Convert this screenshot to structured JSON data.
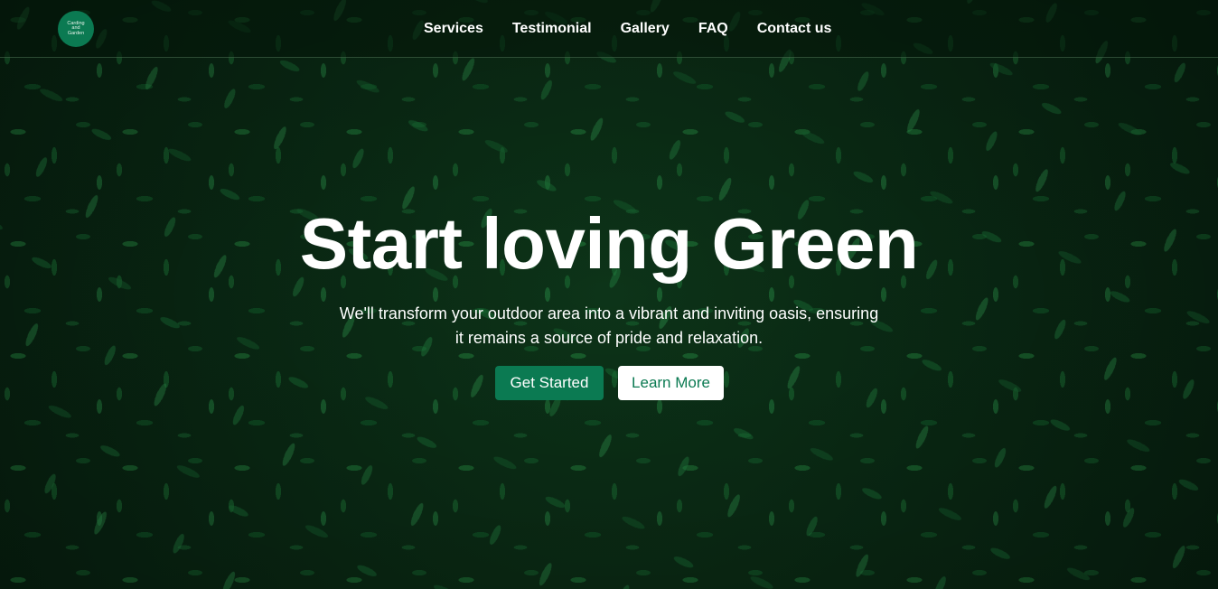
{
  "header": {
    "logo": {
      "line1": "Carding",
      "line2": "and",
      "line3": "Garden"
    },
    "nav": [
      {
        "label": "Services"
      },
      {
        "label": "Testimonial"
      },
      {
        "label": "Gallery"
      },
      {
        "label": "FAQ"
      },
      {
        "label": "Contact us"
      }
    ]
  },
  "hero": {
    "title": "Start loving Green",
    "subtitle": "We'll transform your outdoor area into a vibrant and inviting oasis, ensuring it remains a source of pride and relaxation.",
    "primary_button": "Get Started",
    "secondary_button": "Learn More",
    "background": "leaf-texture-image"
  },
  "colors": {
    "brand": "#0b7a52",
    "text_light": "#ffffff"
  }
}
